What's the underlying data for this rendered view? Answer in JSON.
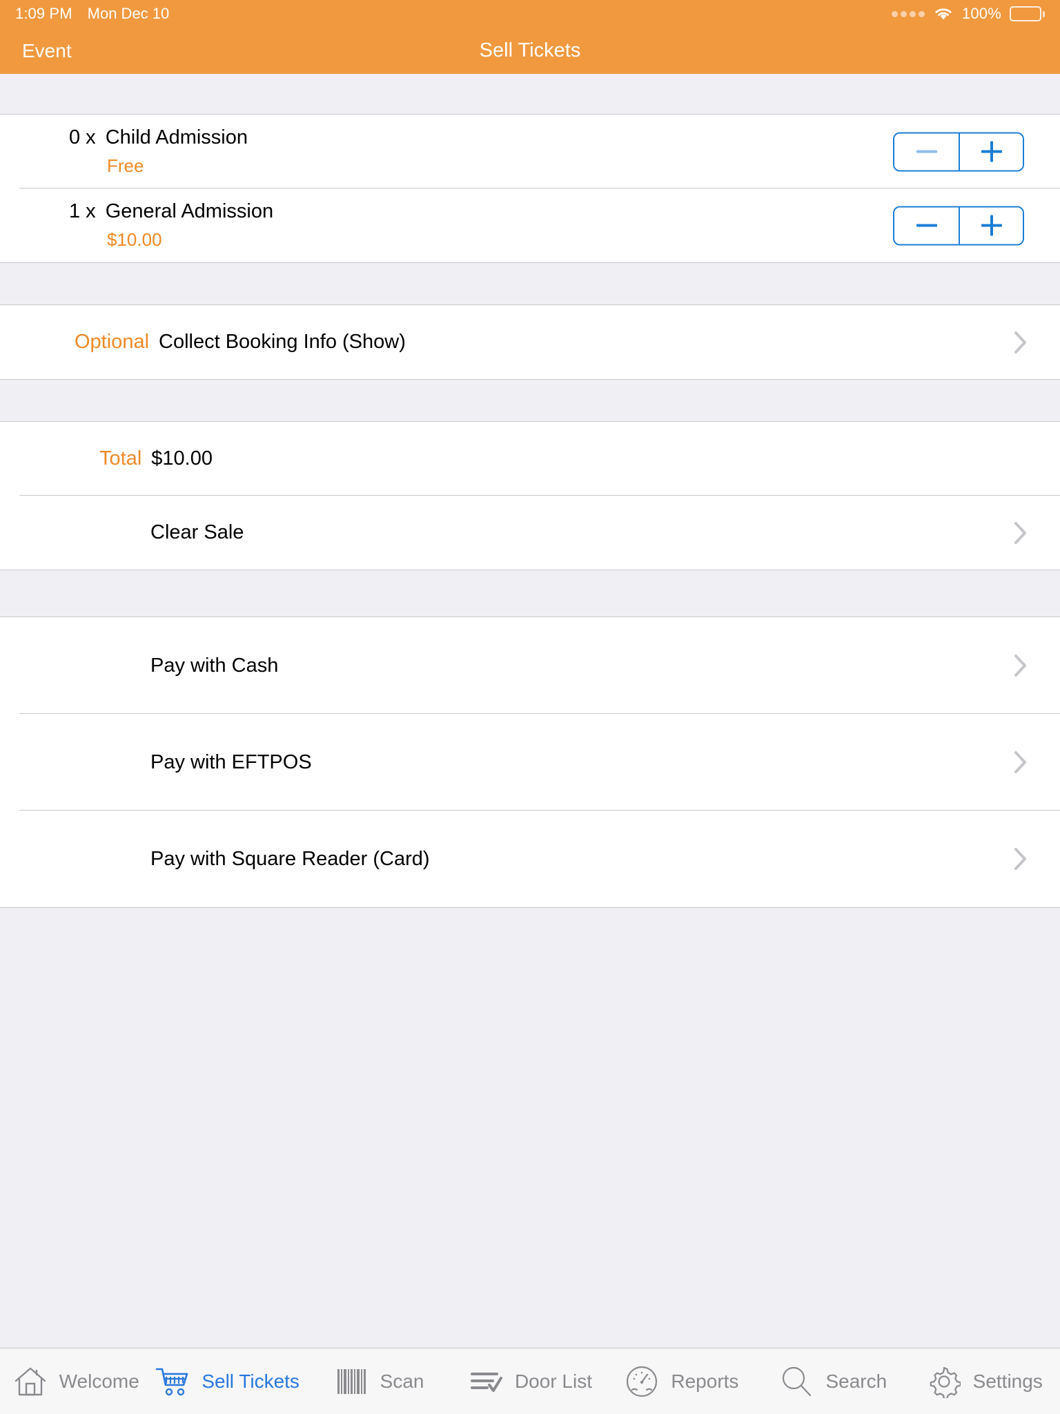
{
  "status_bar": {
    "time": "1:09 PM",
    "date": "Mon Dec 10",
    "signal_icon": "signal-dots-icon",
    "wifi_icon": "wifi-icon",
    "battery_percent": "100%",
    "battery_icon": "battery-full-icon"
  },
  "nav": {
    "back_label": "Event",
    "title": "Sell Tickets"
  },
  "colors": {
    "brand_orange": "#F0993F",
    "accent_orange": "#EE8A26",
    "tint_blue": "#1A7DD6",
    "tab_active_blue": "#2878DE",
    "tab_inactive_gray": "#8A8A8E",
    "separator": "#C8C7CC",
    "group_background": "#EFEFF4"
  },
  "tickets": [
    {
      "quantity": "0 x",
      "name": "Child Admission",
      "price": "Free",
      "decrement_label": "−",
      "increment_label": "+",
      "decrement_enabled": false,
      "increment_enabled": true
    },
    {
      "quantity": "1 x",
      "name": "General Admission",
      "price": "$10.00",
      "decrement_label": "−",
      "increment_label": "+",
      "decrement_enabled": true,
      "increment_enabled": true
    }
  ],
  "booking_info": {
    "badge": "Optional",
    "label": "Collect Booking Info (Show)",
    "chevron_icon": "chevron-right-icon"
  },
  "total": {
    "label": "Total",
    "value": "$10.00"
  },
  "clear_sale": {
    "label": "Clear Sale",
    "chevron_icon": "chevron-right-icon"
  },
  "payment_options": [
    {
      "label": "Pay with Cash",
      "chevron_icon": "chevron-right-icon"
    },
    {
      "label": "Pay with EFTPOS",
      "chevron_icon": "chevron-right-icon"
    },
    {
      "label": "Pay with Square Reader (Card)",
      "chevron_icon": "chevron-right-icon"
    }
  ],
  "tab_bar": [
    {
      "label": "Welcome",
      "icon": "home-icon",
      "active": false
    },
    {
      "label": "Sell Tickets",
      "icon": "cart-icon",
      "active": true
    },
    {
      "label": "Scan",
      "icon": "barcode-icon",
      "active": false
    },
    {
      "label": "Door List",
      "icon": "list-check-icon",
      "active": false
    },
    {
      "label": "Reports",
      "icon": "gauge-icon",
      "active": false
    },
    {
      "label": "Search",
      "icon": "search-icon",
      "active": false
    },
    {
      "label": "Settings",
      "icon": "gear-icon",
      "active": false
    }
  ]
}
